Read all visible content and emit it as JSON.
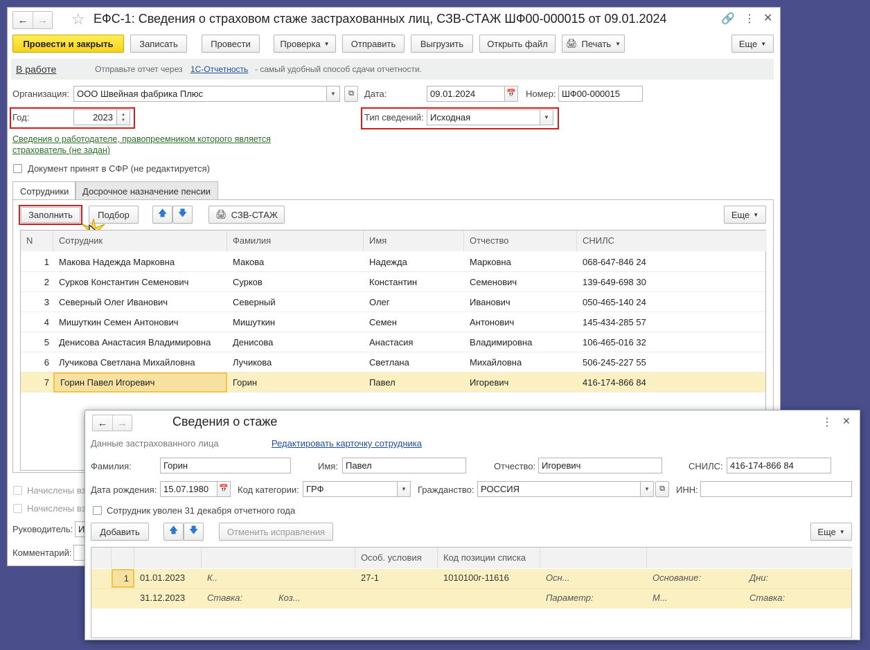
{
  "main": {
    "title": "ЕФС-1: Сведения о страховом стаже застрахованных лиц, СЗВ-СТАЖ ШФ00-000015 от 09.01.2024",
    "toolbar": {
      "post_close": "Провести и закрыть",
      "save": "Записать",
      "post": "Провести",
      "check": "Проверка",
      "send": "Отправить",
      "upload": "Выгрузить",
      "open_file": "Открыть файл",
      "print": "Печать",
      "more": "Еще"
    },
    "status": {
      "state": "В работе",
      "msg_prefix": "Отправьте отчет через",
      "msg_link": "1С-Отчетность",
      "msg_suffix": "- самый удобный способ сдачи отчетности."
    },
    "org_label": "Организация:",
    "org_value": "ООО Швейная фабрика Плюс",
    "date_label": "Дата:",
    "date_value": "09.01.2024",
    "number_label": "Номер:",
    "number_value": "ШФ00-000015",
    "year_label": "Год:",
    "year_value": "2023",
    "type_label": "Тип сведений:",
    "type_value": "Исходная",
    "employer_link_1": "Сведения о работодателе, правопреемником которого является",
    "employer_link_2": "страхователь (не задан)",
    "accepted_label": "Документ принят в СФР (не редактируется)",
    "tabs": [
      "Сотрудники",
      "Досрочное назначение пенсии"
    ],
    "table_toolbar": {
      "fill": "Заполнить",
      "pick": "Подбор",
      "szv": "СЗВ-СТАЖ",
      "more": "Еще"
    },
    "columns": [
      "N",
      "Сотрудник",
      "Фамилия",
      "Имя",
      "Отчество",
      "СНИЛС"
    ],
    "rows": [
      [
        "1",
        "Макова Надежда Марковна",
        "Макова",
        "Надежда",
        "Марковна",
        "068-647-846 24"
      ],
      [
        "2",
        "Сурков Константин Семенович",
        "Сурков",
        "Константин",
        "Семенович",
        "139-649-698 30"
      ],
      [
        "3",
        "Северный Олег Иванович",
        "Северный",
        "Олег",
        "Иванович",
        "050-465-140 24"
      ],
      [
        "4",
        "Мишуткин Семен Антонович",
        "Мишуткин",
        "Семен",
        "Антонович",
        "145-434-285 57"
      ],
      [
        "5",
        "Денисова Анастасия Владимировна",
        "Денисова",
        "Анастасия",
        "Владимировна",
        "106-465-016 32"
      ],
      [
        "6",
        "Лучикова Светлана Михайловна",
        "Лучикова",
        "Светлана",
        "Михайловна",
        "506-245-227 55"
      ],
      [
        "7",
        "Горин Павел Игоревич",
        "Горин",
        "Павел",
        "Игоревич",
        "416-174-866 84"
      ]
    ],
    "bottom": {
      "accrued_1": "Начислены вз",
      "accrued_2": "Начислены вз",
      "manager_label": "Руководитель:",
      "manager_value": "И",
      "comment_label": "Комментарий:"
    }
  },
  "dialog": {
    "title": "Сведения о стаже",
    "insured_label": "Данные застрахованного лица",
    "edit_link": "Редактировать карточку сотрудника",
    "last_label": "Фамилия:",
    "last_value": "Горин",
    "first_label": "Имя:",
    "first_value": "Павел",
    "middle_label": "Отчество:",
    "middle_value": "Игоревич",
    "snils_label": "СНИЛС:",
    "snils_value": "416-174-866 84",
    "birth_label": "Дата рождения:",
    "birth_value": "15.07.1980",
    "cat_label": "Код категории:",
    "cat_value": "ГРФ",
    "citizen_label": "Гражданство:",
    "citizen_value": "РОССИЯ",
    "inn_label": "ИНН:",
    "inn_value": "",
    "fired_label": "Сотрудник уволен 31 декабря отчетного года",
    "add": "Добавить",
    "cancel_fix": "Отменить исправления",
    "more": "Еще",
    "col_conditions": "Особ. условия",
    "col_position": "Код позиции списка",
    "row": {
      "num": "1",
      "start": "01.01.2023",
      "end": "31.12.2023",
      "k": "К..",
      "stavka": "Ставка:",
      "koz": "Коз...",
      "cond": "27-1",
      "pos": "1010100г-11616",
      "osn_short": "Осн...",
      "param": "Параметр:",
      "osnovanie": "Основание:",
      "m": "М...",
      "days": "Дни:",
      "stavka2": "Ставка:"
    }
  }
}
